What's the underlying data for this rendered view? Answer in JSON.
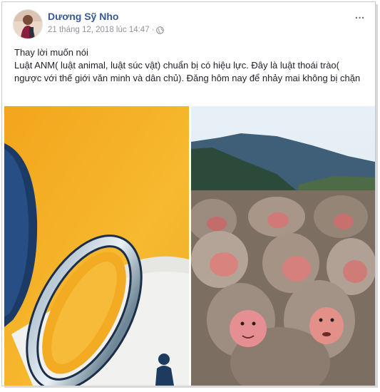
{
  "post": {
    "author": "Dương Sỹ Nho",
    "timestamp": "21 tháng 12, 2018 lúc 14:47",
    "separator": "·",
    "privacy_icon": "globe-icon",
    "more_icon": "more-options-icon",
    "more_label": "...",
    "text_lines": [
      "Thay lời muốn nói",
      "Luật ANM( luật animal, luật súc vật) chuẩn bị có hiệu lực. Đây là luật thoái trào( ngược với thế giới văn minh và dân chủ). Đăng hôm nay để nhảy mai không bị chặn"
    ],
    "images": [
      "left-image",
      "right-image"
    ]
  },
  "colors": {
    "author_link": "#385898",
    "meta_text": "#90949c",
    "body_text": "#1d2129",
    "left_bg": "#f5b62e"
  }
}
